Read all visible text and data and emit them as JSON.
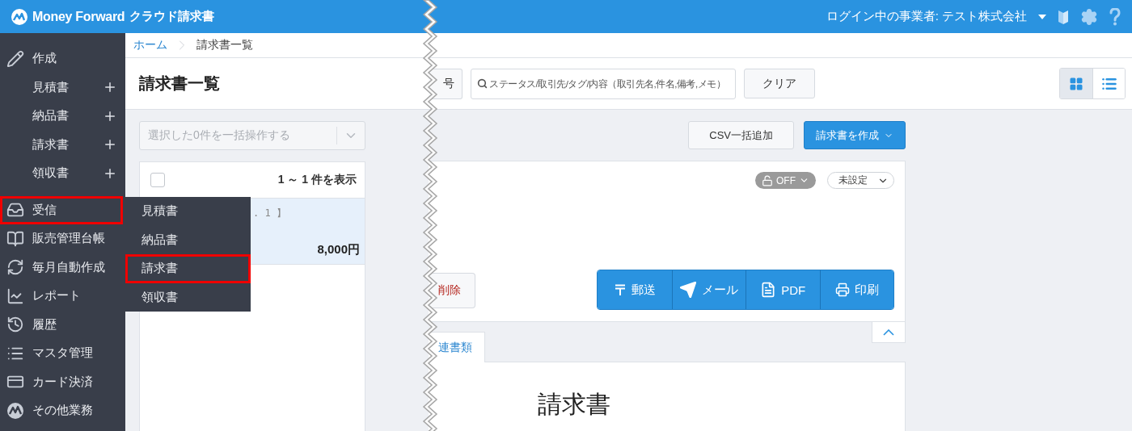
{
  "header": {
    "brand": "Money Forward",
    "product": "クラウド請求書",
    "account": "ログイン中の事業者: テスト株式会社"
  },
  "sidebar": {
    "items": [
      {
        "label": "作成",
        "kind": "group",
        "highlighted": false,
        "children": [
          {
            "label": "見積書"
          },
          {
            "label": "納品書"
          },
          {
            "label": "請求書"
          },
          {
            "label": "領収書"
          }
        ]
      },
      {
        "label": "受信",
        "kind": "item",
        "highlighted": true
      },
      {
        "label": "販売管理台帳",
        "kind": "item",
        "highlighted": false
      },
      {
        "label": "毎月自動作成",
        "kind": "item",
        "highlighted": false
      },
      {
        "label": "レポート",
        "kind": "item",
        "highlighted": false
      },
      {
        "label": "履歴",
        "kind": "item",
        "highlighted": false
      },
      {
        "label": "マスタ管理",
        "kind": "item",
        "highlighted": false
      },
      {
        "label": "カード決済",
        "kind": "item",
        "highlighted": false
      },
      {
        "label": "その他業務",
        "kind": "item",
        "highlighted": false
      }
    ]
  },
  "submenu": {
    "items": [
      {
        "label": "見積書",
        "highlighted": false
      },
      {
        "label": "納品書",
        "highlighted": false
      },
      {
        "label": "請求書",
        "highlighted": true
      },
      {
        "label": "領収書",
        "highlighted": false
      }
    ]
  },
  "breadcrumb": [
    "ホーム",
    "請求書一覧"
  ],
  "page_title": "請求書一覧",
  "toolbar": {
    "cut_button": "号",
    "search": {
      "placeholder": "ステータス/取引先/タグ/内容（取引先名,件名,備考,メモ）"
    },
    "clear_button": "クリア",
    "view_toggle": [
      {
        "kind": "grid",
        "selected": true
      },
      {
        "kind": "list",
        "selected": false
      }
    ]
  },
  "bulk_action": {
    "placeholder": "選択した0件を一括操作する",
    "disabled": true
  },
  "list": {
    "select_all": {
      "checked": false
    },
    "count": "1 ～ 1 件を表示",
    "rows": [
      {
        "number_fragment": ". 1 】",
        "amount": "8,000円",
        "selected": true
      }
    ]
  },
  "action_buttons": [
    {
      "label": "CSV一括追加",
      "kind": "default"
    },
    {
      "label": "請求書を作成",
      "kind": "primary"
    }
  ],
  "detail": {
    "lock": {
      "label": "OFF",
      "locked": false
    },
    "status_select": "未設定",
    "delete_button": "削除",
    "send_buttons": [
      "郵送",
      "メール",
      "PDF",
      "印刷"
    ]
  },
  "tabs": [
    {
      "label": "連書類",
      "selected": true
    }
  ],
  "document": {
    "title": "請求書"
  }
}
